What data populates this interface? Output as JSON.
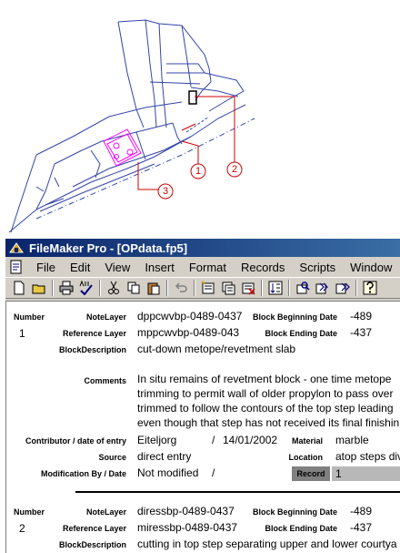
{
  "cad": {
    "callouts": [
      "1",
      "2",
      "3"
    ],
    "colors": {
      "outline": "#3344aa",
      "line": "#cc0000",
      "highlight": "#ff00ff"
    }
  },
  "window": {
    "title": "FileMaker Pro - [OPdata.fp5]",
    "colors": {
      "titlebar": "#0a246a",
      "chrome": "#d4d0c8"
    }
  },
  "menu": [
    "File",
    "Edit",
    "View",
    "Insert",
    "Format",
    "Records",
    "Scripts",
    "Window"
  ],
  "toolbar": {
    "icons": [
      "new-icon",
      "open-icon",
      "print-icon",
      "spellcheck-icon",
      "cut-icon",
      "copy-icon",
      "paste-icon",
      "undo-icon",
      "new-record-icon",
      "duplicate-record-icon",
      "delete-record-icon",
      "sort-icon",
      "find-icon",
      "replace-icon",
      "omit-icon",
      "help-icon"
    ]
  },
  "labels": {
    "number": "Number",
    "note_layer": "NoteLayer",
    "reference_layer": "Reference Layer",
    "block_description": "BlockDescription",
    "block_beginning_date": "Block Beginning Date",
    "block_ending_date": "Block Ending Date",
    "comments": "Comments",
    "contributor": "Contributor / date of entry",
    "source": "Source",
    "modification": "Modification By / Date",
    "material": "Material",
    "location": "Location",
    "record": "Record"
  },
  "records": [
    {
      "number": "1",
      "note_layer": "dppcwvbp-0489-0437",
      "reference_layer": "mppcwvbp-0489-043",
      "block_beginning_date": "-489",
      "block_ending_date": "-437",
      "block_description": "cut-down metope/revetment slab",
      "comments": [
        "In situ remains of revetment block - one time metope",
        "trimming to permit wall of older propylon to pass over",
        "trimmed to follow the contours of the top step leading",
        "even though that step has not received its final finishin"
      ],
      "contributor": "Eiteljorg",
      "date_separator": "/",
      "entry_date": "14/01/2002",
      "material": "marble",
      "source": "direct entry",
      "location": "atop steps div",
      "modification": "Not modified",
      "modification_separator": "/",
      "record": "1"
    },
    {
      "number": "2",
      "note_layer": "diressbp-0489-0437",
      "reference_layer": "miressbp-0489-0437",
      "block_beginning_date": "-489",
      "block_ending_date": "-437",
      "block_description": "cutting in top step separating upper and lower courtya"
    }
  ]
}
